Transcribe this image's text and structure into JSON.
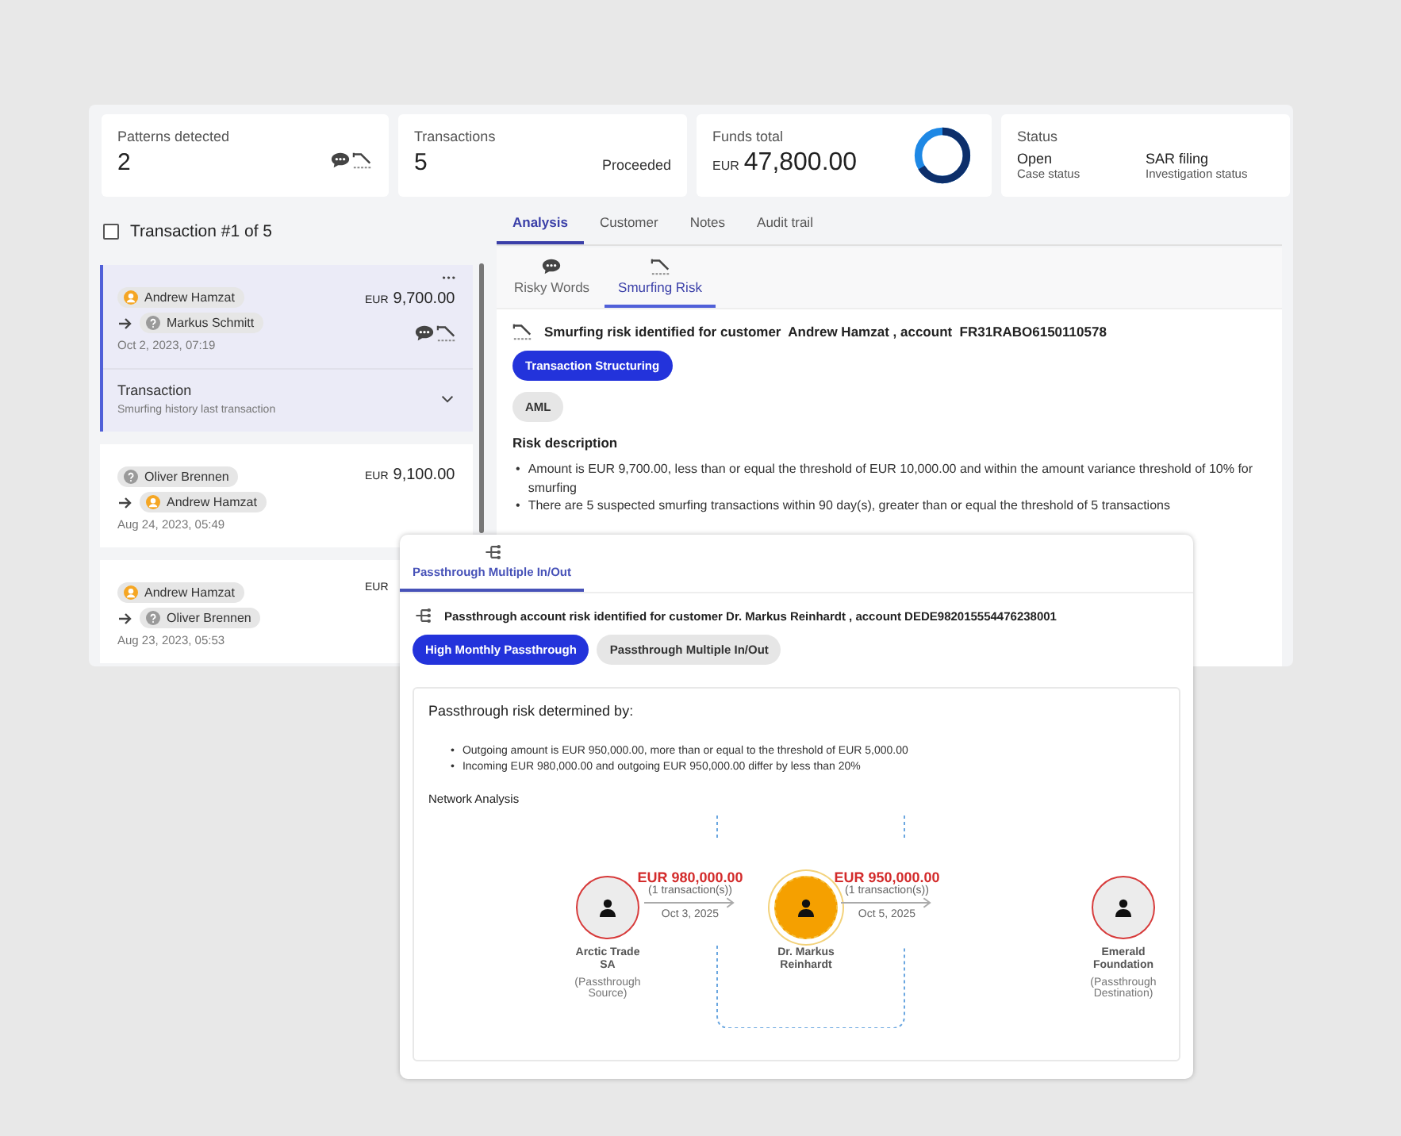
{
  "stats": [
    {
      "kind": "patterns",
      "label": "Patterns detected",
      "value": "2"
    },
    {
      "kind": "transactions",
      "label": "Transactions",
      "value": "5",
      "note": "Proceeded"
    },
    {
      "kind": "funds",
      "label": "Funds total",
      "currency": "EUR",
      "value": "47,800.00"
    },
    {
      "kind": "status",
      "label": "Status",
      "items": [
        {
          "value": "Open",
          "caption": "Case status"
        },
        {
          "value": "SAR filing",
          "caption": "Investigation status"
        }
      ]
    }
  ],
  "transaction_list": {
    "checked": false,
    "title": "Transaction #1 of 5",
    "items": [
      {
        "selected": true,
        "from": {
          "name": "Andrew Hamzat",
          "kind": "known"
        },
        "to": {
          "name": "Markus Schmitt",
          "kind": "unknown"
        },
        "date": "Oct 2, 2023, 07:19",
        "currency": "EUR",
        "amount": "9,700.00",
        "menu": "•••",
        "patterns": true,
        "expanded": true,
        "detail_title": "Transaction",
        "detail_text": "Smurfing history last transaction"
      },
      {
        "selected": false,
        "from": {
          "name": "Oliver Brennen",
          "kind": "unknown"
        },
        "to": {
          "name": "Andrew Hamzat",
          "kind": "known"
        },
        "date": "Aug 24, 2023, 05:49",
        "currency": "EUR",
        "amount": "9,100.00",
        "patterns": false,
        "expanded": false
      },
      {
        "selected": false,
        "from": {
          "name": "Andrew Hamzat",
          "kind": "known"
        },
        "to": {
          "name": "Oliver Brennen",
          "kind": "unknown"
        },
        "date": "Aug 23, 2023, 05:53",
        "currency": "EUR",
        "patterns": false,
        "expanded": false
      }
    ]
  },
  "tabs": [
    {
      "label": "Analysis",
      "selected": true
    },
    {
      "label": "Customer",
      "selected": false
    },
    {
      "label": "Notes",
      "selected": false
    },
    {
      "label": "Audit trail",
      "selected": false
    }
  ],
  "analysis": {
    "subtabs": [
      {
        "kind": "words",
        "label": "Risky Words",
        "selected": false
      },
      {
        "kind": "smurfing",
        "label": "Smurfing Risk",
        "selected": true
      }
    ],
    "heading": "Smurfing risk identified for customer  Andrew Hamzat , account  FR31RABO6150110578",
    "tags": [
      {
        "label": "Transaction Structuring",
        "selected": true
      },
      {
        "label": "AML",
        "selected": false
      }
    ],
    "section_title": "Risk description",
    "marker": "•",
    "bullets": [
      "Amount is EUR 9,700.00, less than or equal the threshold of EUR 10,000.00 and within the amount variance threshold of 10% for smurfing",
      "There are 5 suspected smurfing transactions within 90 day(s), greater than or equal the threshold of 5 transactions"
    ]
  },
  "passthrough": {
    "tabs": [
      {
        "label": "Passthrough Multiple In/Out",
        "selected": true
      }
    ],
    "heading": "Passthrough account risk identified for customer Dr. Markus Reinhardt , account DEDE982015554476238001",
    "tags": [
      {
        "label": "High Monthly Passthrough",
        "selected": true
      },
      {
        "label": "Passthrough Multiple In/Out",
        "selected": false
      }
    ],
    "box_title": "Passthrough risk determined by:",
    "marker": "•",
    "bullets": [
      "Outgoing amount is EUR 950,000.00, more than or equal to the threshold of EUR 5,000.00",
      "Incoming EUR 980,000.00 and outgoing EUR 950,000.00 differ by less than 20%"
    ],
    "network_title": "Network Analysis",
    "nodes": [
      {
        "kind": "source",
        "name": "Arctic Trade SA",
        "role": "(Passthrough Source)"
      },
      {
        "kind": "subject",
        "name": "Dr. Markus Reinhardt"
      },
      {
        "kind": "destination",
        "name": "Emerald Foundation",
        "role": "(Passthrough Destination)"
      }
    ],
    "flows": [
      {
        "amount": "EUR 980,000.00",
        "count": "(1 transaction(s))",
        "date": "Oct 3, 2025"
      },
      {
        "amount": "EUR 950,000.00",
        "count": "(1 transaction(s))",
        "date": "Oct 5, 2025"
      }
    ]
  }
}
